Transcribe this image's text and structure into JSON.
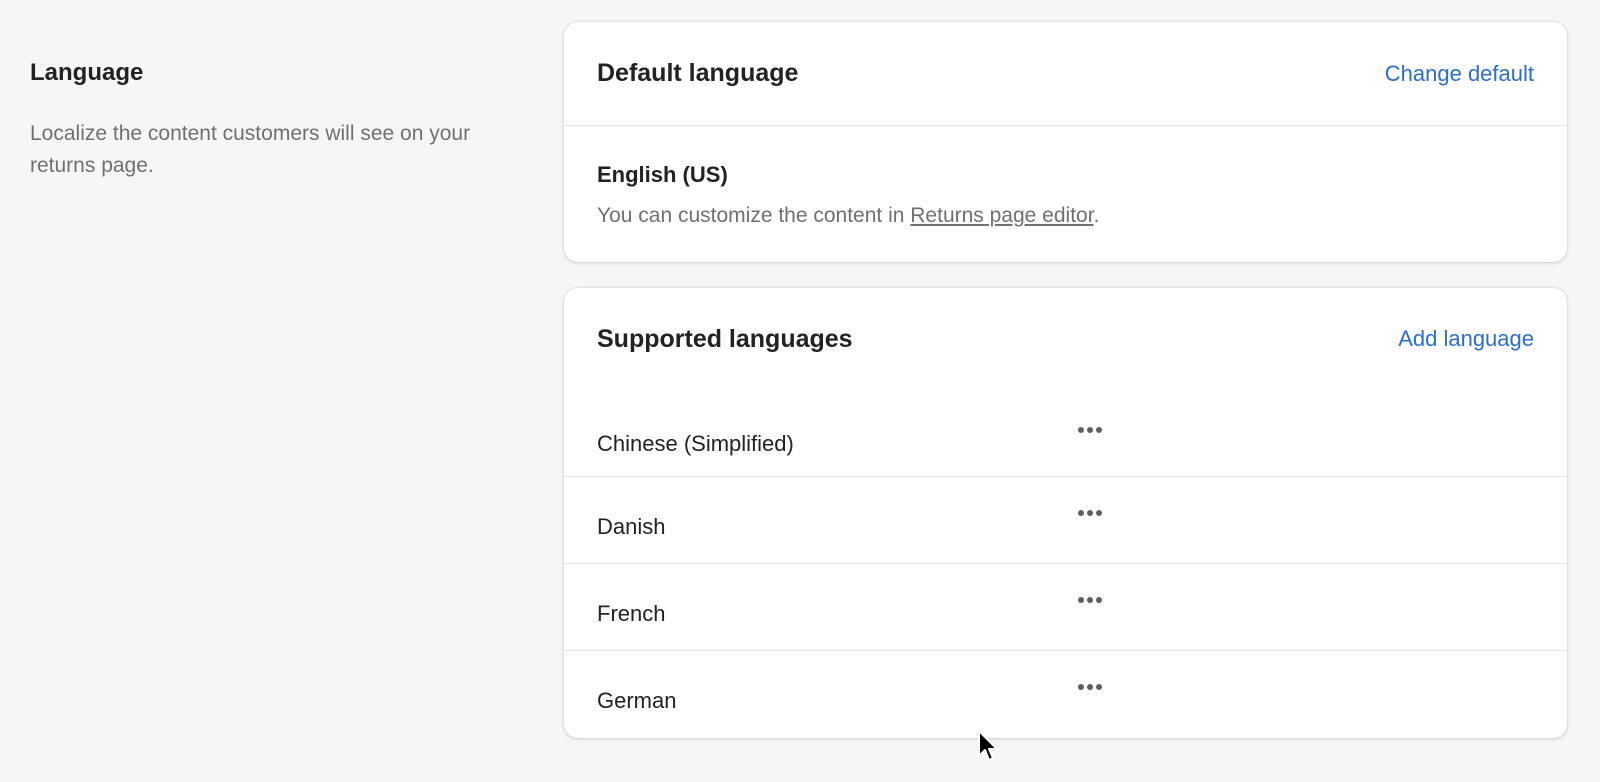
{
  "section": {
    "title": "Language",
    "description": "Localize the content customers will see on your returns page."
  },
  "default_card": {
    "title": "Default language",
    "action_label": "Change default",
    "language": "English (US)",
    "help_prefix": "You can customize the content in ",
    "help_link": "Returns page editor",
    "help_suffix": "."
  },
  "supported_card": {
    "title": "Supported languages",
    "action_label": "Add language",
    "languages": [
      {
        "name": "Chinese (Simplified)"
      },
      {
        "name": "Danish"
      },
      {
        "name": "French"
      },
      {
        "name": "German"
      }
    ]
  },
  "colors": {
    "background": "#f6f6f7",
    "link": "#2c6ecb",
    "text": "#202223",
    "subdued": "#6d7175"
  }
}
